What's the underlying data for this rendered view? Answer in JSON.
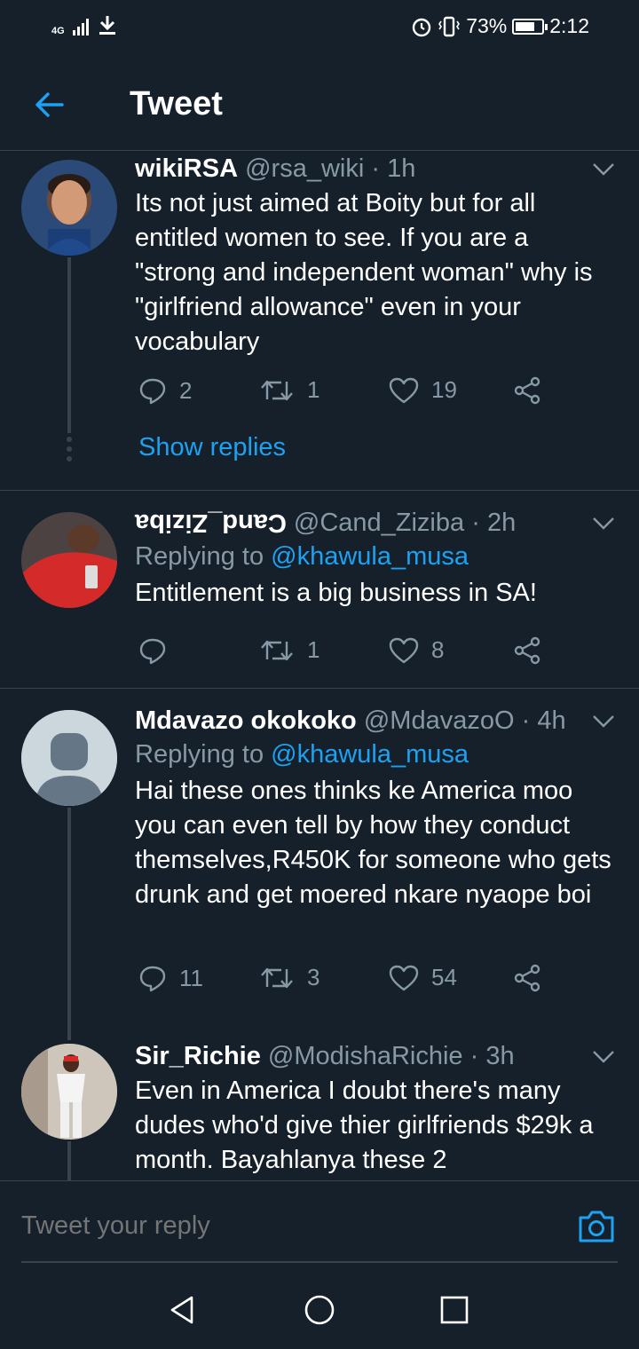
{
  "status_bar": {
    "network": "4G",
    "battery": "73%",
    "battery_level": 0.73,
    "time": "2:12",
    "icons": [
      "signal-icon",
      "download-icon",
      "alarm-icon",
      "vibrate-icon",
      "battery-icon"
    ]
  },
  "header": {
    "title": "Tweet",
    "back_icon": "back-arrow-icon"
  },
  "tweets": [
    {
      "name": "wikiRSA",
      "handle": "@rsa_wiki",
      "time": "1h",
      "text": "Its not just aimed at Boity but for all entitled women to see. If you are a \"strong and independent woman\" why is \"girlfriend allowance\" even in your vocabulary",
      "replies": "2",
      "retweets": "1",
      "likes": "19",
      "show_replies": "Show replies"
    },
    {
      "name": "Cand_Ziziba",
      "handle": "@Cand_Ziziba",
      "time": "2h",
      "replying_label": "Replying to",
      "replying_to": "@khawula_musa",
      "text": "Entitlement is a big business in SA!",
      "replies": "",
      "retweets": "1",
      "likes": "8"
    },
    {
      "name": "Mdavazo okokoko",
      "handle": "@MdavazoO",
      "time": "4h",
      "replying_label": "Replying to",
      "replying_to": "@khawula_musa",
      "text": "Hai these ones thinks ke America moo you can even tell by how they conduct themselves,R450K for someone who gets drunk and get moered nkare nyaope boi",
      "replies": "11",
      "retweets": "3",
      "likes": "54"
    },
    {
      "name": "Sir_Richie",
      "handle": "@ModishaRichie",
      "time": "3h",
      "text": "Even in America I doubt there's many dudes who'd give thier girlfriends $29k a month. Bayahlanya these 2"
    }
  ],
  "separator": "·",
  "reply_bar": {
    "placeholder": "Tweet your reply",
    "camera_icon": "camera-icon"
  },
  "nav_bar": {
    "icons": [
      "nav-back-icon",
      "nav-home-icon",
      "nav-recents-icon"
    ]
  },
  "colors": {
    "background": "#15202b",
    "border": "#38444d",
    "secondary_text": "#8899a6",
    "accent": "#1da1f2"
  }
}
